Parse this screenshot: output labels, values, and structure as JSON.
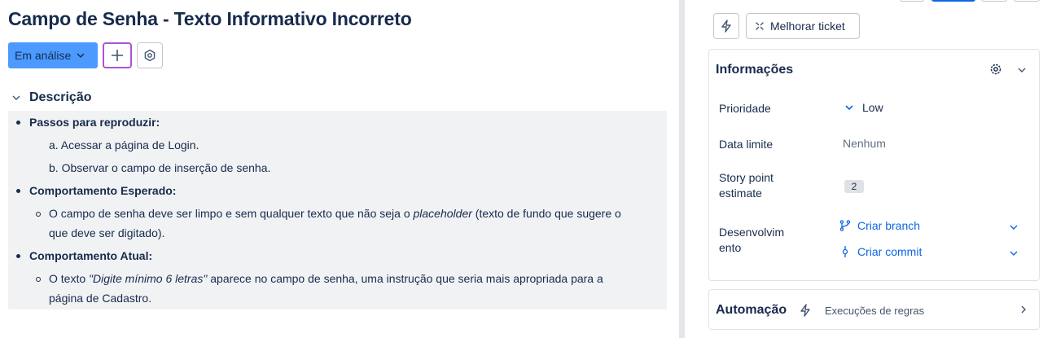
{
  "issue": {
    "title": "Campo de Senha - Texto Informativo Incorreto",
    "status_label": "Em análise"
  },
  "description": {
    "heading": "Descrição",
    "sections": [
      {
        "title": "Passos para reproduzir:",
        "items": [
          "a. Acessar a página de Login.",
          "b. Observar o campo de inserção de senha."
        ]
      },
      {
        "title": "Comportamento Esperado:",
        "line1_pre": "O campo de senha deve ser limpo e sem qualquer texto que não seja o ",
        "line1_em": "placeholder",
        "line1_post": " (texto de fundo que sugere o",
        "line2": "que deve ser digitado)."
      },
      {
        "title": "Comportamento Atual:",
        "line1_pre": "O texto ",
        "line1_em": "\"Digite mínimo 6 letras\"",
        "line1_post": " aparece no campo de senha, uma instrução que seria mais apropriada para a",
        "line2": "página de Cadastro."
      }
    ]
  },
  "toolbar": {
    "improve_label": "Melhorar ticket"
  },
  "details": {
    "heading": "Informações",
    "priority_label": "Prioridade",
    "priority_value": "Low",
    "due_label": "Data limite",
    "due_value": "Nenhum",
    "sp_label_1": "Story point",
    "sp_label_2": "estimate",
    "sp_value": "2",
    "dev_label_1": "Desenvolvim",
    "dev_label_2": "ento",
    "create_branch": "Criar branch",
    "create_commit": "Criar commit"
  },
  "automation": {
    "heading": "Automação",
    "rule_executions": "Execuções de regras"
  },
  "colors": {
    "status_bg": "#4c9aff",
    "link": "#0c66e4",
    "focus_ring": "#a855d8",
    "description_bg": "#f1f2f4"
  },
  "icons": [
    "chevron-down-icon",
    "plus-icon",
    "hexagon-settings-icon",
    "bolt-icon",
    "sparkle-icon",
    "gear-icon",
    "branch-icon",
    "commit-icon",
    "chevron-right-icon"
  ]
}
